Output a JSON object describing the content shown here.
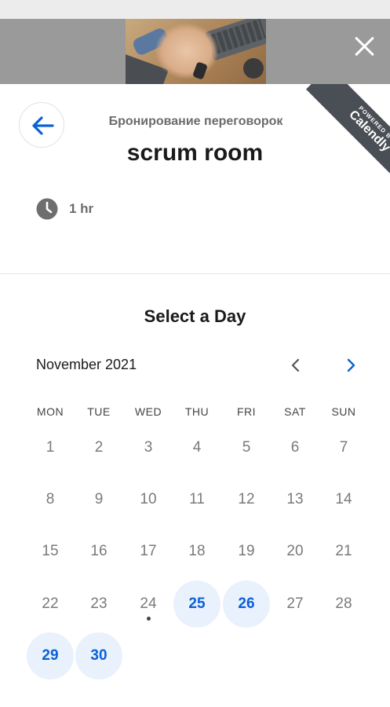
{
  "header": {
    "close_icon": "close-icon",
    "banner_image": "team-hands-photo"
  },
  "ribbon": {
    "powered": "POWERED BY",
    "brand": "Calendly"
  },
  "event": {
    "owner": "Бронирование переговорок",
    "title": "scrum room",
    "duration": "1 hr",
    "back_icon": "arrow-left-icon"
  },
  "calendar": {
    "heading": "Select a Day",
    "month_label": "November 2021",
    "weekdays": [
      "MON",
      "TUE",
      "WED",
      "THU",
      "FRI",
      "SAT",
      "SUN"
    ],
    "weeks": [
      [
        "1",
        "2",
        "3",
        "4",
        "5",
        "6",
        "7"
      ],
      [
        "8",
        "9",
        "10",
        "11",
        "12",
        "13",
        "14"
      ],
      [
        "15",
        "16",
        "17",
        "18",
        "19",
        "20",
        "21"
      ],
      [
        "22",
        "23",
        "24",
        "25",
        "26",
        "27",
        "28"
      ],
      [
        "29",
        "30"
      ]
    ],
    "available_days": [
      "25",
      "26",
      "29",
      "30"
    ],
    "today": "24"
  },
  "colors": {
    "accent": "#0a61d4",
    "available_bg": "#e9f1fd",
    "ribbon": "#4a4f55",
    "muted_text": "#7a7a7a"
  }
}
